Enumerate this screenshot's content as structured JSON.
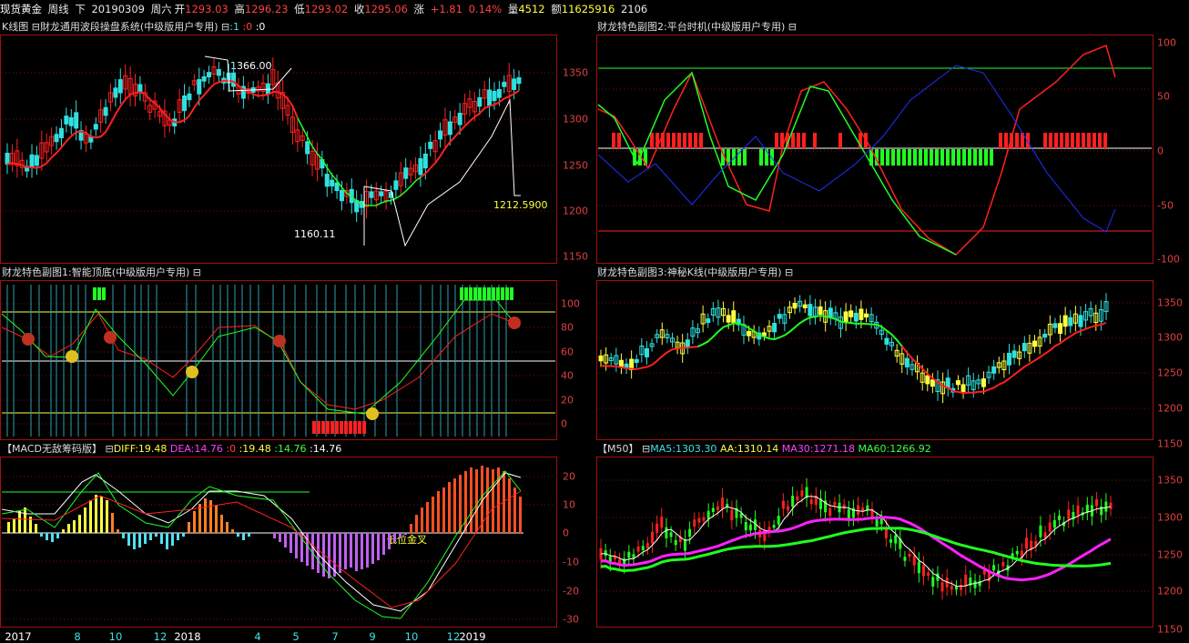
{
  "header": {
    "instrument": "现货黄金",
    "period": "周线",
    "direction": "下",
    "date": "20190309",
    "weekday": "周六",
    "open_label": "开",
    "open": "1293.03",
    "high_label": "高",
    "high": "1296.23",
    "low_label": "低",
    "low": "1293.02",
    "close_label": "收",
    "close": "1295.06",
    "change_label": "涨",
    "change": "+1.81",
    "change_pct": "0.14%",
    "volume_label": "量",
    "volume": "4512",
    "amount_label": "额",
    "amount": "11625916",
    "extra": "2106"
  },
  "panels": {
    "kline": {
      "title": "K线图",
      "indicator": "財龙通用波段操盘系统(中级版用户专用)",
      "params": "日:1 :0 :0",
      "param_values": [
        ":1",
        ":0",
        ":0"
      ],
      "annotations": {
        "high": "1366.00",
        "low": "1160.11",
        "last": "1212.5900"
      },
      "ticks": [
        "1350",
        "1300",
        "1250",
        "1200",
        "1150"
      ]
    },
    "sub2": {
      "title": "财龙特色副图2:平台时机(中级版用户专用)",
      "ticks": [
        "100",
        "50",
        "0",
        "-50",
        "-100"
      ]
    },
    "sub1": {
      "title": "财龙特色副图1:智能顶底(中级版用户专用)",
      "ticks": [
        "100",
        "80",
        "60",
        "40",
        "20",
        "0"
      ]
    },
    "sub3": {
      "title": "财龙特色副图3:神秘K线(中级版用户专用)",
      "ticks": [
        "1350",
        "1300",
        "1250",
        "1200",
        "1150"
      ]
    },
    "macd": {
      "title": "【MACD无敌筹码版】",
      "diff_label": "DIFF:19.48",
      "dea_label": "DEA:14.76",
      "v0": ":0",
      "v1": ":19.48",
      "v2": ":14.76",
      "v3": ":14.76",
      "annotation": "低位金叉",
      "ticks": [
        "20",
        "10",
        "0",
        "-10",
        "-20",
        "-30"
      ]
    },
    "ma": {
      "title": "【M50】",
      "ma5": "MA5:1303.30",
      "aa": "AA:1310.14",
      "ma30": "MA30:1271.18",
      "ma60": "MA60:1266.92",
      "ticks": [
        "1350",
        "1300",
        "1250",
        "1200",
        "1150"
      ]
    }
  },
  "date_axis": [
    {
      "label": "2017",
      "color": "#ffffff"
    },
    {
      "label": "8",
      "color": "#40e0e0"
    },
    {
      "label": "10",
      "color": "#40e0e0"
    },
    {
      "label": "12",
      "color": "#40e0e0"
    },
    {
      "label": "2018",
      "color": "#ffffff"
    },
    {
      "label": "4",
      "color": "#40e0e0"
    },
    {
      "label": "5",
      "color": "#40e0e0"
    },
    {
      "label": "7",
      "color": "#40e0e0"
    },
    {
      "label": "9",
      "color": "#40e0e0"
    },
    {
      "label": "10",
      "color": "#40e0e0"
    },
    {
      "label": "12",
      "color": "#40e0e0"
    },
    {
      "label": "2019",
      "color": "#ffffff"
    }
  ],
  "colors": {
    "up": "#ff2020",
    "down": "#30e0e0",
    "green": "#20ff20",
    "yellow": "#ffff40",
    "magenta": "#ff20ff",
    "border": "#a01010",
    "axis_text": "#e04040"
  }
}
